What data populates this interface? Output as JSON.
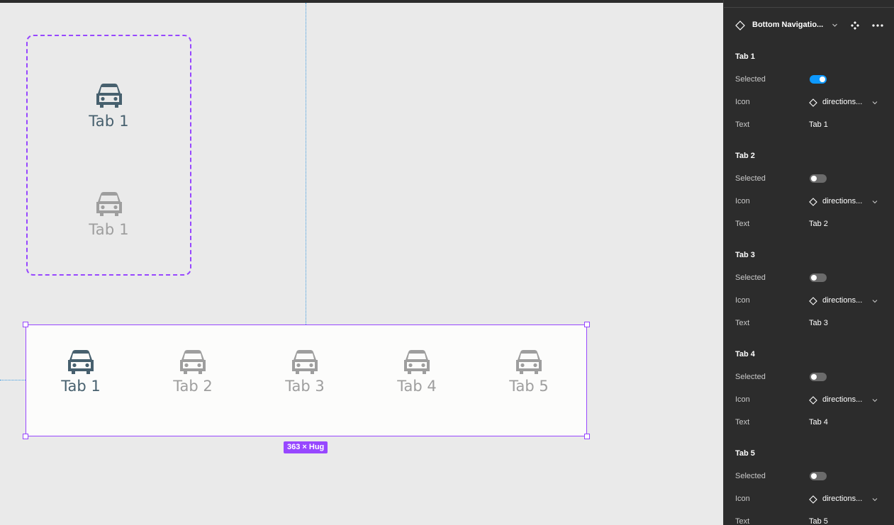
{
  "canvas": {
    "variant_set": {
      "variants": [
        {
          "label": "Tab 1",
          "state": "selected"
        },
        {
          "label": "Tab 1",
          "state": "unselected"
        }
      ]
    },
    "instance": {
      "tabs": [
        {
          "label": "Tab 1",
          "selected": true,
          "icon": "car-icon"
        },
        {
          "label": "Tab 2",
          "selected": false,
          "icon": "car-icon"
        },
        {
          "label": "Tab 3",
          "selected": false,
          "icon": "car-icon"
        },
        {
          "label": "Tab 4",
          "selected": false,
          "icon": "car-icon"
        },
        {
          "label": "Tab 5",
          "selected": false,
          "icon": "car-icon"
        }
      ],
      "size_label": "363 × Hug"
    },
    "colors": {
      "selection": "#9747ff",
      "active_tab": "#47606e",
      "inactive_tab": "#9e9e9e"
    }
  },
  "panel": {
    "component_name": "Bottom Navigatio...",
    "labels": {
      "selected": "Selected",
      "icon": "Icon",
      "text": "Text"
    },
    "groups": [
      {
        "title": "Tab 1",
        "selected": true,
        "icon_value": "directions...",
        "text_value": "Tab 1"
      },
      {
        "title": "Tab 2",
        "selected": false,
        "icon_value": "directions...",
        "text_value": "Tab 2"
      },
      {
        "title": "Tab 3",
        "selected": false,
        "icon_value": "directions...",
        "text_value": "Tab 3"
      },
      {
        "title": "Tab 4",
        "selected": false,
        "icon_value": "directions...",
        "text_value": "Tab 4"
      },
      {
        "title": "Tab 5",
        "selected": false,
        "icon_value": "directions...",
        "text_value": "Tab 5"
      }
    ],
    "colors": {
      "background": "#2c2c2c",
      "toggle_on": "#0d99ff",
      "toggle_off": "#6b6b6b"
    }
  }
}
